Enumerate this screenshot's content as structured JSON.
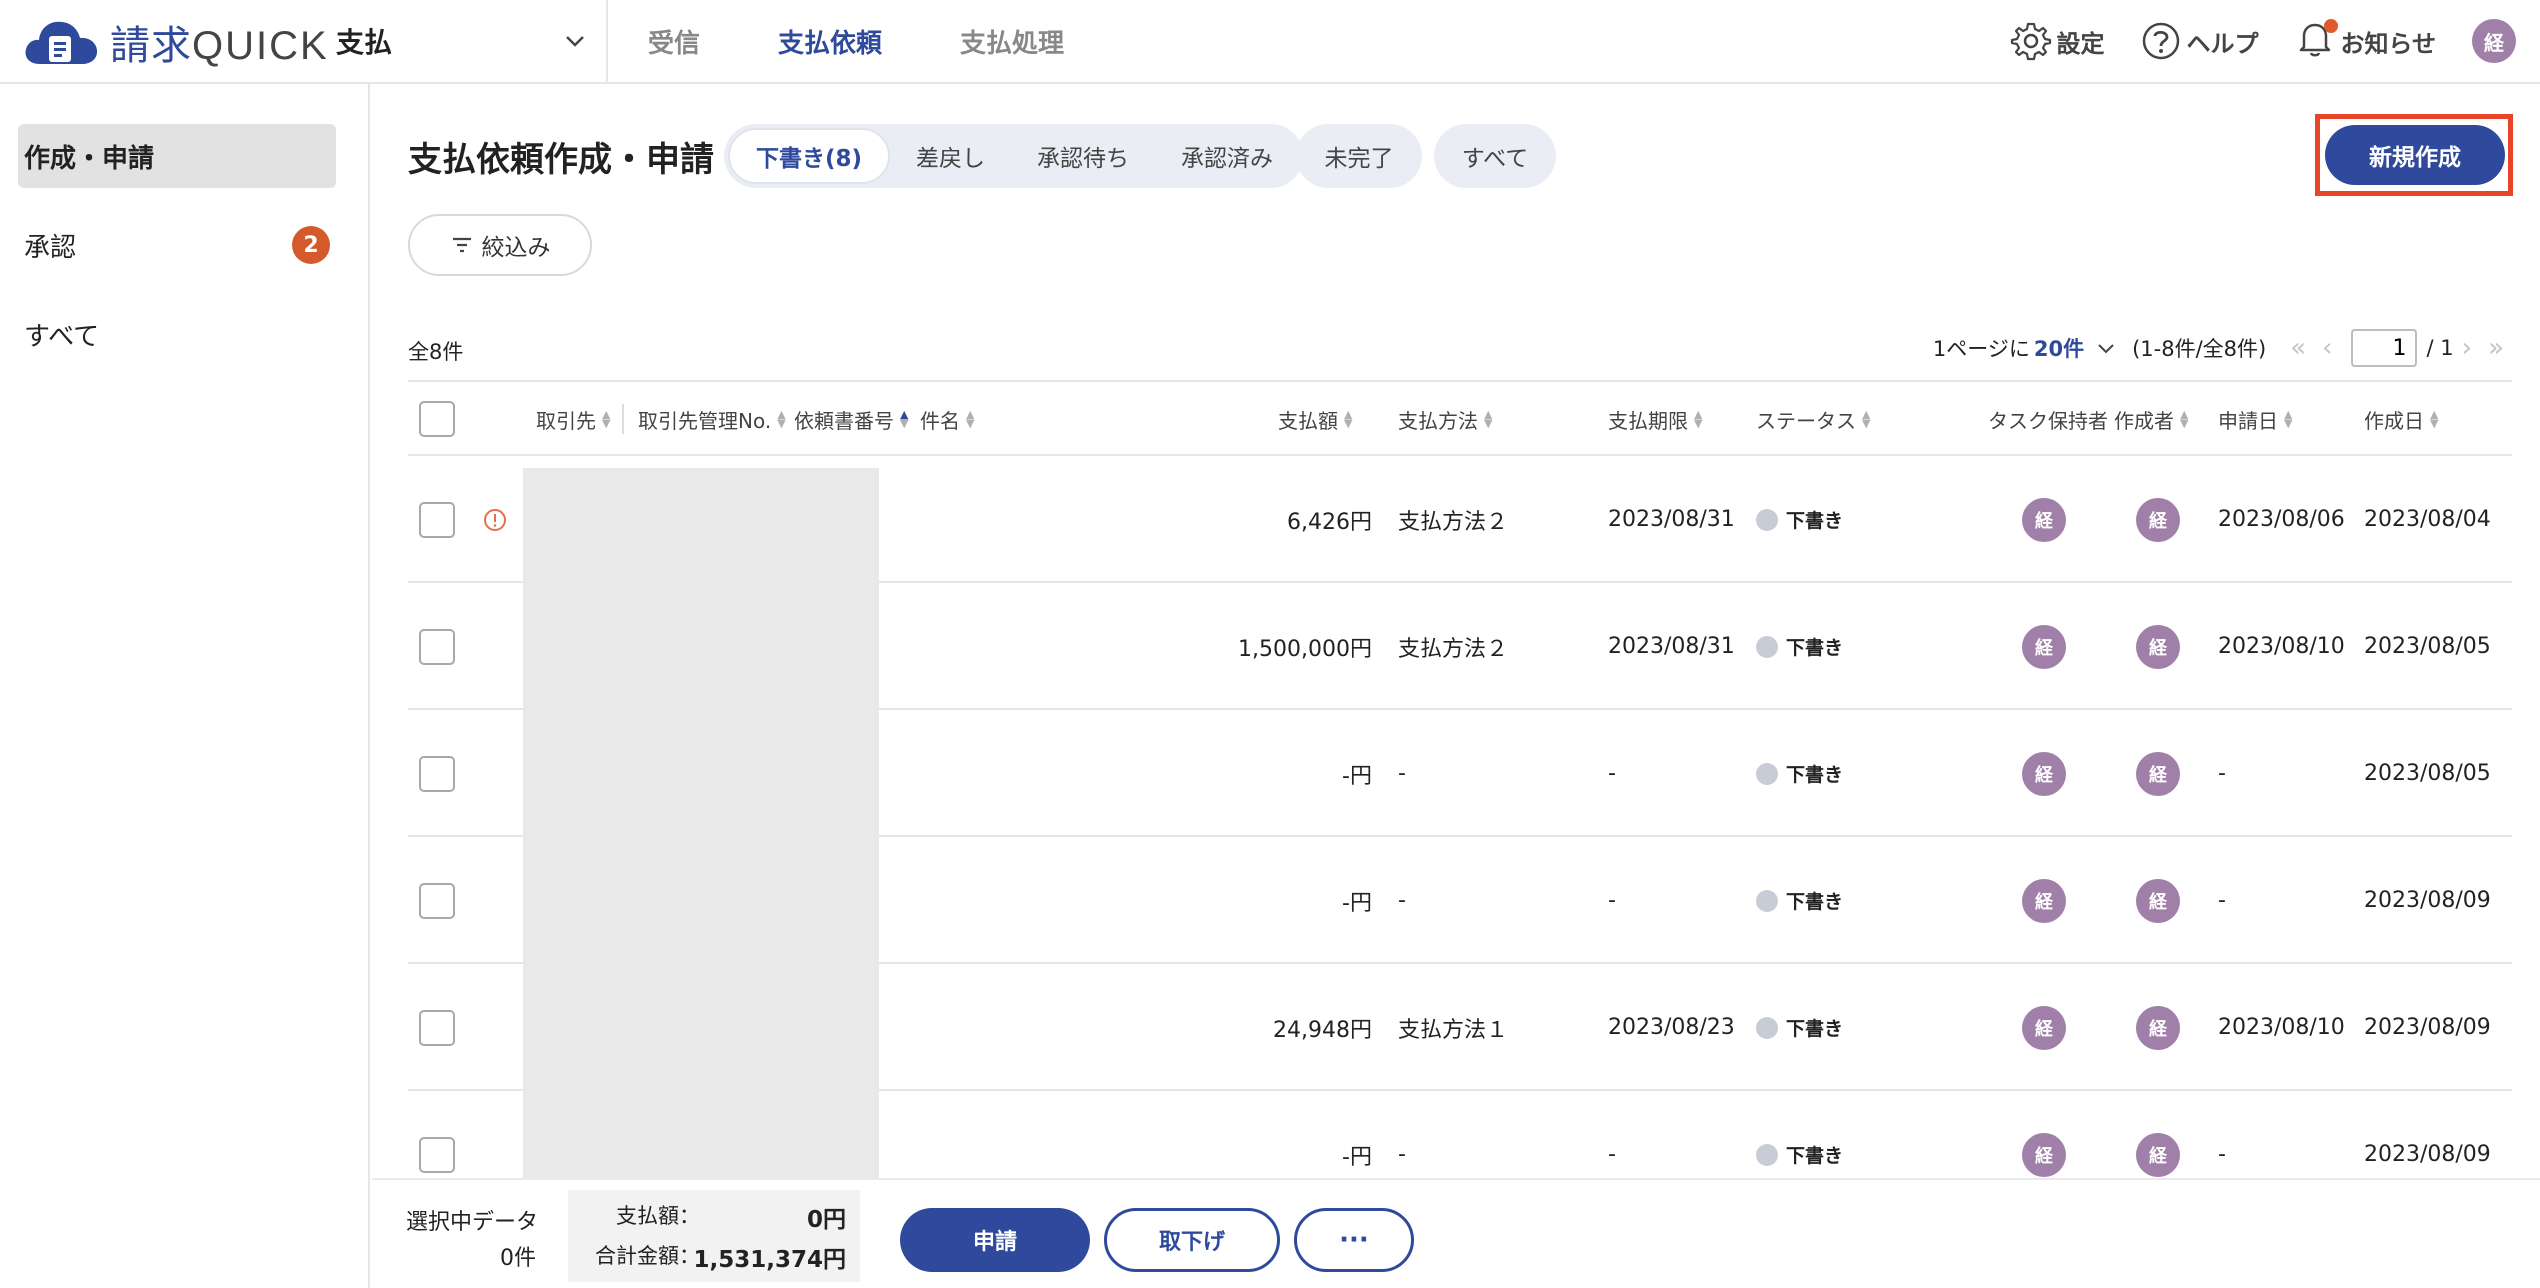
{
  "header": {
    "logo_text": "請求",
    "logo_text_q": "QUICK",
    "app_select": "支払",
    "nav": [
      "受信",
      "支払依頼",
      "支払処理"
    ],
    "settings": "設定",
    "help": "ヘルプ",
    "notifications": "お知らせ",
    "avatar": "経"
  },
  "sidebar": {
    "items": [
      {
        "label": "作成・申請"
      },
      {
        "label": "承認",
        "badge": "2"
      },
      {
        "label": "すべて"
      }
    ]
  },
  "main": {
    "title": "支払依頼作成・申請",
    "tabs": [
      "下書き(8)",
      "差戻し",
      "承認待ち",
      "承認済み"
    ],
    "tab_incomplete": "未完了",
    "tab_all": "すべて",
    "new_button": "新規作成",
    "filter_button": "絞込み",
    "total": "全8件",
    "pager": {
      "per_page_label": "1ページに",
      "per_page_value": "20件",
      "range": "(1-8件/全8件)",
      "current_page": "1",
      "total_pages": "/ 1"
    }
  },
  "table": {
    "columns": {
      "partner": "取引先",
      "partner_no": "取引先管理No.",
      "request_no": "依頼書番号",
      "subject": "件名",
      "amount": "支払額",
      "method": "支払方法",
      "due": "支払期限",
      "status": "ステータス",
      "holder": "タスク保持者",
      "creator": "作成者",
      "applied": "申請日",
      "created": "作成日"
    },
    "rows": [
      {
        "warn": true,
        "amount": "6,426円",
        "method": "支払方法２",
        "due": "2023/08/31",
        "status": "下書き",
        "holder": "経",
        "creator": "経",
        "applied": "2023/08/06",
        "created": "2023/08/04"
      },
      {
        "warn": false,
        "amount": "1,500,000円",
        "method": "支払方法２",
        "due": "2023/08/31",
        "status": "下書き",
        "holder": "経",
        "creator": "経",
        "applied": "2023/08/10",
        "created": "2023/08/05"
      },
      {
        "warn": false,
        "amount": "-円",
        "method": "-",
        "due": "-",
        "status": "下書き",
        "holder": "経",
        "creator": "経",
        "applied": "-",
        "created": "2023/08/05"
      },
      {
        "warn": false,
        "amount": "-円",
        "method": "-",
        "due": "-",
        "status": "下書き",
        "holder": "経",
        "creator": "経",
        "applied": "-",
        "created": "2023/08/09"
      },
      {
        "warn": false,
        "amount": "24,948円",
        "method": "支払方法１",
        "due": "2023/08/23",
        "status": "下書き",
        "holder": "経",
        "creator": "経",
        "applied": "2023/08/10",
        "created": "2023/08/09"
      },
      {
        "warn": false,
        "amount": "-円",
        "method": "-",
        "due": "-",
        "status": "下書き",
        "holder": "経",
        "creator": "経",
        "applied": "-",
        "created": "2023/08/09"
      }
    ]
  },
  "footer": {
    "selected_label": "選択中データ",
    "selected_count": "0件",
    "amount_label": "支払額：",
    "amount_value": "0円",
    "total_label": "合計金額：",
    "total_value": "1,531,374円",
    "apply_button": "申請",
    "withdraw_button": "取下げ",
    "more_button": "···"
  },
  "colors": {
    "brand": "#2f4a9c",
    "highlight_outline": "#e8442a",
    "badge": "#d45a2b",
    "avatar": "#a07fa8"
  }
}
